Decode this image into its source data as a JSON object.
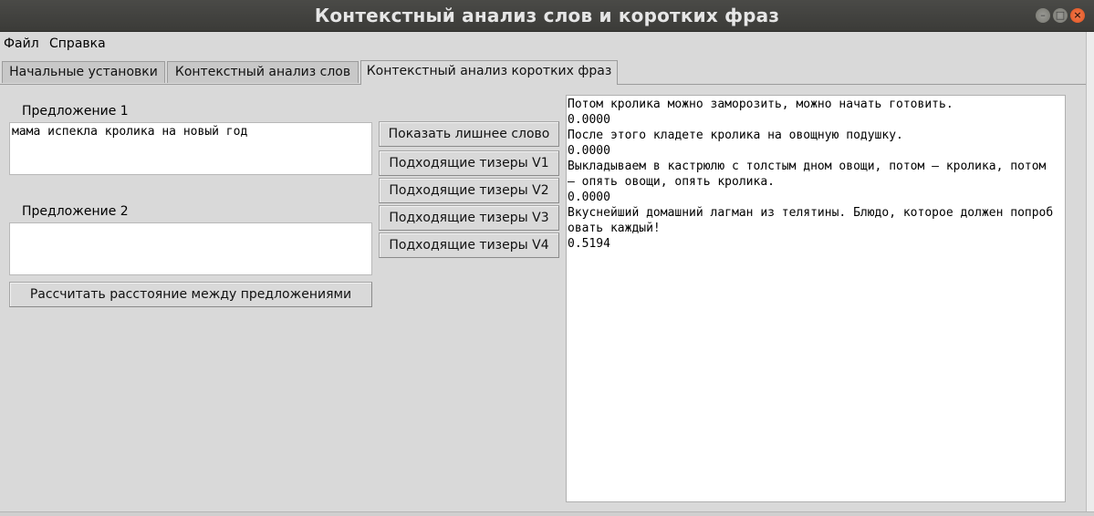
{
  "window": {
    "title": "Контекстный анализ слов и коротких фраз",
    "controls": {
      "minimize": "–",
      "maximize": "□",
      "close": "×"
    }
  },
  "menu": {
    "items": [
      "Файл",
      "Справка"
    ]
  },
  "tabs": [
    {
      "label": "Начальные установки",
      "active": false
    },
    {
      "label": "Контекстный анализ слов",
      "active": false
    },
    {
      "label": "Контекстный анализ коротких фраз",
      "active": true
    }
  ],
  "form": {
    "sentence1_label": "Предложение 1",
    "sentence1_value": "мама испекла кролика на новый год",
    "sentence2_label": "Предложение 2",
    "sentence2_value": "",
    "calc_button": "Рассчитать расстояние между предложениями"
  },
  "actions": [
    "Показать лишнее слово",
    "Подходящие тизеры V1",
    "Подходящие тизеры V2",
    "Подходящие тизеры V3",
    "Подходящие тизеры V4"
  ],
  "output": {
    "lines": [
      "Потом кролика можно заморозить, можно начать готовить.",
      "0.0000",
      "После этого кладете кролика на овощную подушку.",
      "0.0000",
      "Выкладываем в кастрюлю с толстым дном овощи, потом — кролика, потом",
      "— опять овощи, опять кролика.",
      "0.0000",
      "Вкуснейший домашний лагман из телятины. Блюдо, которое должен попроб",
      "овать каждый!",
      "0.5194"
    ]
  }
}
